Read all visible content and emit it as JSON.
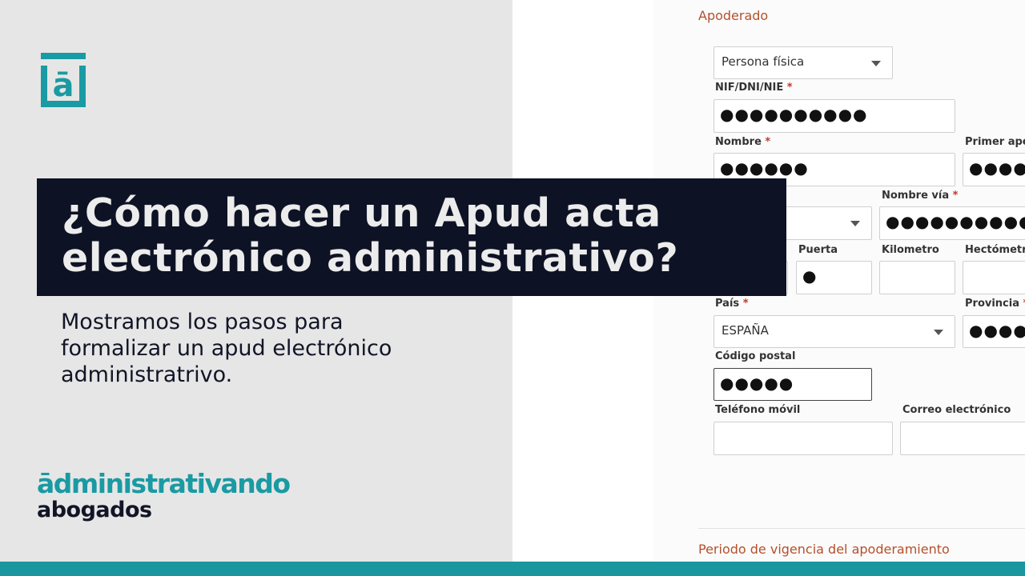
{
  "brand": {
    "logo_letter": "ā",
    "name": "ādministrativando",
    "sub": "abogados",
    "accent_color": "#1a9aa3",
    "dark_color": "#0e1225"
  },
  "title": {
    "line1": "¿Cómo hacer un Apud acta",
    "line2": "electrónico administrativo?"
  },
  "subtitle": {
    "line1": "Mostramos los pasos para",
    "line2": "formalizar un apud electrónico",
    "line3": "administratrivo."
  },
  "form": {
    "section_title": "Apoderado",
    "footer_section_title": "Periodo de vigencia del apoderamiento",
    "person_type": {
      "value": "Persona física"
    },
    "fields": {
      "nif": {
        "label": "NIF/DNI/NIE",
        "required": "*",
        "value": "●●●●●●●●●●"
      },
      "nombre": {
        "label": "Nombre",
        "required": "*",
        "value": "●●●●●●"
      },
      "primer_apellido": {
        "label": "Primer ape",
        "value": "●●●●●"
      },
      "tipo_via": {
        "value": ""
      },
      "nombre_via": {
        "label": "Nombre vía",
        "required": "*",
        "value": "●●●●●●●●●●●"
      },
      "puerta": {
        "label": "Puerta",
        "value": "●"
      },
      "kilometro": {
        "label": "Kilometro",
        "value": ""
      },
      "hectometro": {
        "label": "Hectómetr",
        "value": ""
      },
      "pais": {
        "label": "País",
        "required": "*",
        "value": "ESPAÑA"
      },
      "provincia": {
        "label": "Provincia",
        "required": "*",
        "value": "●●●●●"
      },
      "codigo_postal": {
        "label": "Código postal",
        "value": "●●●●●"
      },
      "telefono": {
        "label": "Teléfono móvil",
        "value": ""
      },
      "correo": {
        "label": "Correo electrónico",
        "value": ""
      }
    }
  }
}
